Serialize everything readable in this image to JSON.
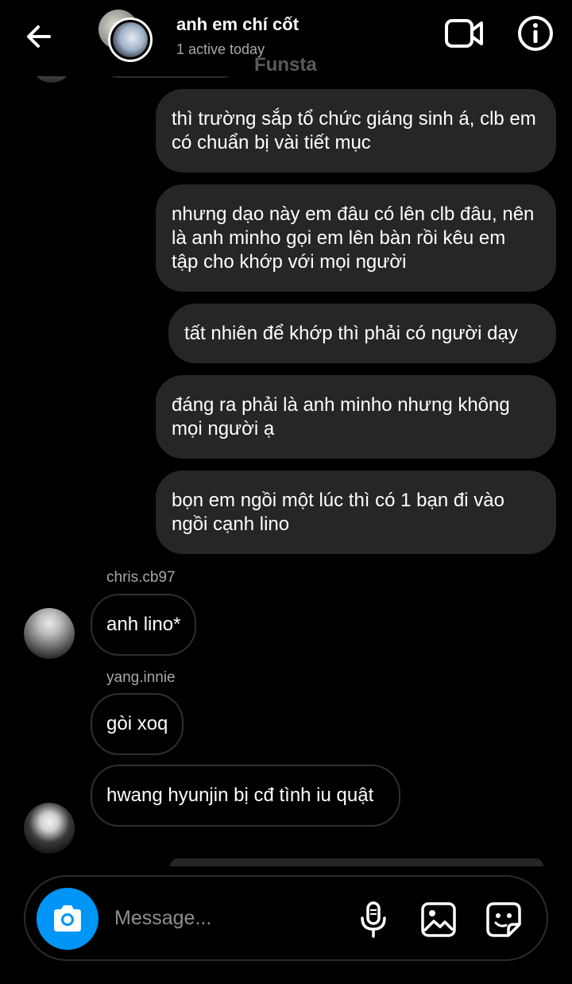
{
  "header": {
    "title": "anh em chí cốt",
    "status": "1 active today",
    "ghost_label": "Funsta"
  },
  "messages": {
    "outgoing": [
      "thì trường sắp tổ chức giáng sinh á, clb em có chuẩn bị vài tiết mục",
      "nhưng dạo này em đâu có lên clb đâu, nên là anh minho gọi em lên bàn rồi kêu em tập cho khớp với mọi người",
      "tất nhiên để khớp thì phải có người dạy",
      "đáng ra phải là anh minho nhưng không mọi người ạ",
      "bọn em ngồi một lúc thì có 1 bạn đi vào ngồi cạnh lino"
    ],
    "incoming": [
      {
        "sender": "chris.cb97",
        "text": "anh lino*"
      },
      {
        "sender": "yang.innie",
        "text": "gòi xoq"
      },
      {
        "sender": "",
        "text": "hwang hyunjin bị cđ tình iu quật"
      }
    ]
  },
  "composer": {
    "placeholder": "Message..."
  },
  "colors": {
    "background": "#000000",
    "outgoing_bubble": "#262626",
    "accent": "#0095f6",
    "secondary_text": "#a8a8a8"
  },
  "icons": [
    "back-arrow-icon",
    "video-call-icon",
    "info-icon",
    "camera-icon",
    "microphone-icon",
    "gallery-icon",
    "sticker-icon"
  ]
}
